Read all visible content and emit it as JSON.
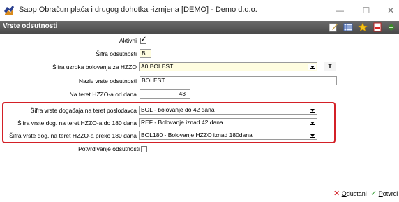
{
  "window": {
    "title": "Saop Obračun plaća i drugog dohotka -izmjena  [DEMO] - Demo d.o.o.",
    "controls": {
      "minimize": "—",
      "maximize": "☐",
      "close": "✕"
    }
  },
  "header": {
    "title": "Vrste odsutnosti",
    "toolbar_icons": [
      "edit-icon",
      "grid-icon",
      "star-icon",
      "pdf-icon",
      "exit-icon"
    ]
  },
  "form": {
    "aktivni": {
      "label": "Aktivni",
      "checked": true,
      "tick": "✓"
    },
    "sifra_odsutnosti": {
      "label": "Šifra odsutnosti",
      "value": "B"
    },
    "sifra_uzroka": {
      "label": "Šifra uzroka bolovanja za HZZO",
      "value": "A0 BOLEST",
      "button": "T"
    },
    "naziv": {
      "label": "Naziv vrste odsutnosti",
      "value": "BOLEST"
    },
    "na_teret_od": {
      "label": "Na teret HZZO-a od dana",
      "value": "43"
    },
    "dogadaj_poslodavac": {
      "label": "Šifra vrste događaja na teret poslodavca",
      "value": "BOL - bolovanje do 42 dana"
    },
    "dog_hzzo_do_180": {
      "label": "Šifra vrste dog. na teret HZZO-a do 180 dana",
      "value": "REF - Bolovanje iznad 42 dana"
    },
    "dog_hzzo_preko_180": {
      "label": "Šifra vrste dog. na teret HZZO-a preko 180 dana",
      "value": "BOL180 - Bolovanje HZZO iznad 180dana"
    },
    "potvrdivanje": {
      "label": "Potvrđivanje odsutnosti",
      "checked": false
    }
  },
  "footer": {
    "cancel": {
      "underline": "O",
      "rest": "dustani",
      "icon": "x-icon"
    },
    "confirm": {
      "underline": "P",
      "rest": "otvrdi",
      "icon": "check-icon"
    }
  },
  "colors": {
    "header_bg": "#555555",
    "highlight": "#d32027",
    "yellow_field": "#fffde0"
  }
}
